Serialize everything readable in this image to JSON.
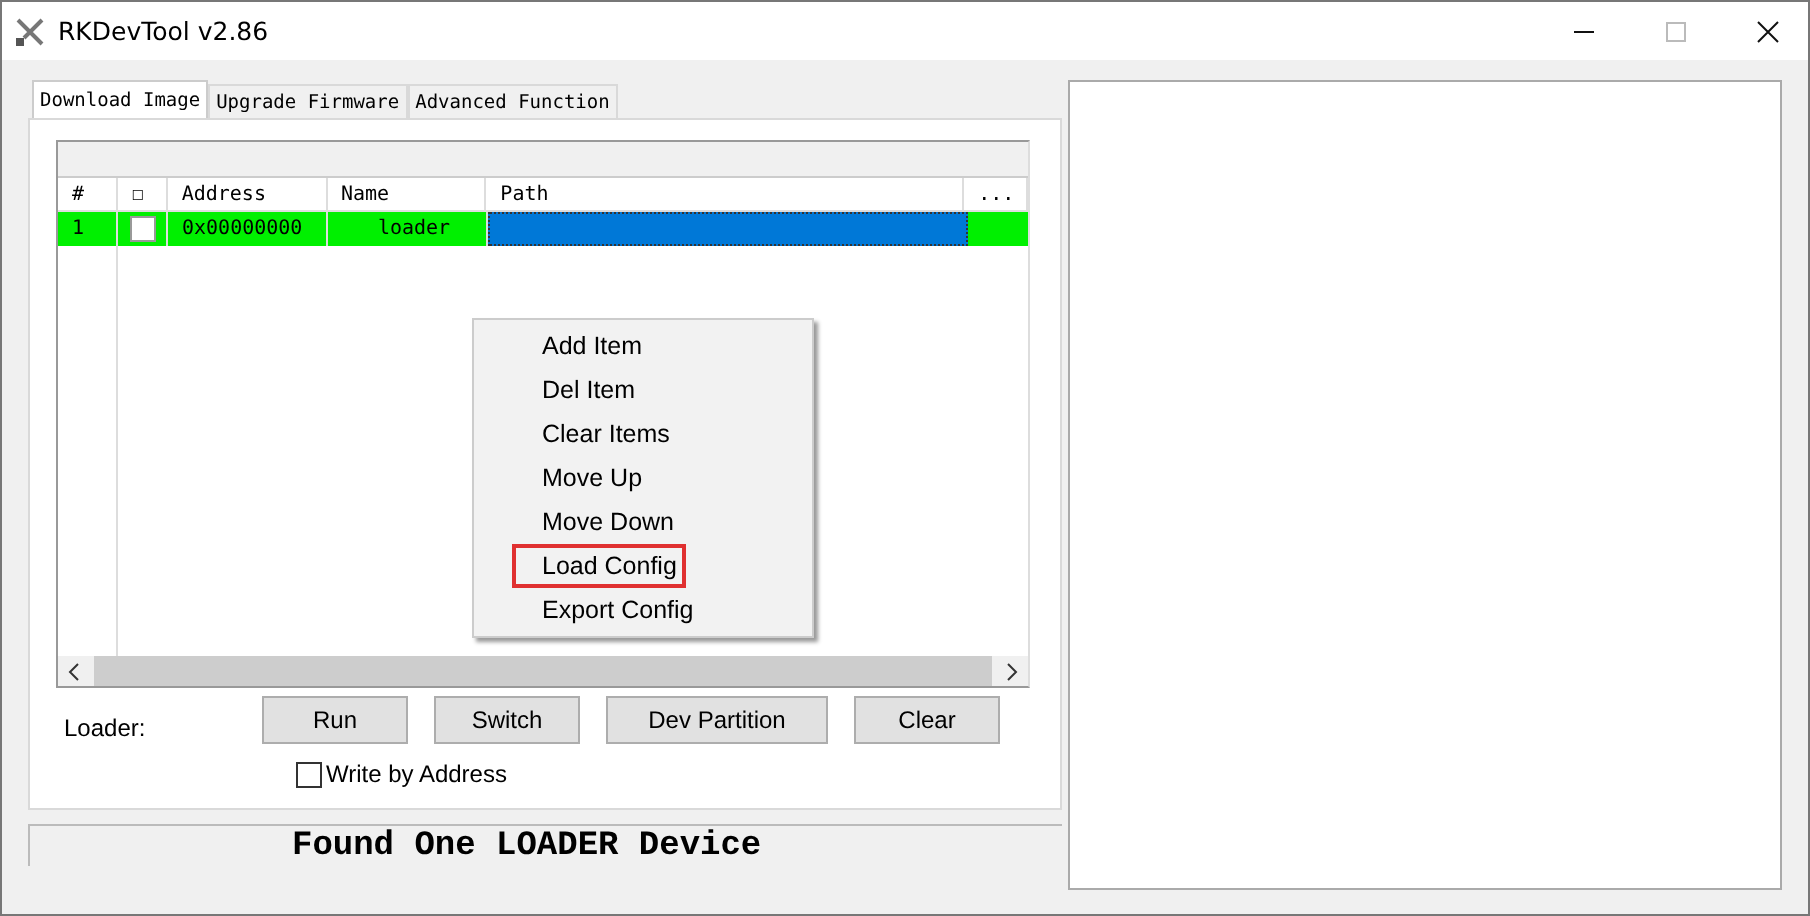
{
  "window": {
    "title": "RKDevTool v2.86"
  },
  "tabs": [
    {
      "label": "Download Image",
      "selected": true
    },
    {
      "label": "Upgrade Firmware",
      "selected": false
    },
    {
      "label": "Advanced Function",
      "selected": false
    }
  ],
  "table": {
    "columns": [
      "#",
      "☐",
      "Address",
      "Name",
      "Path",
      "..."
    ],
    "rows": [
      {
        "number": "1",
        "checked": false,
        "address": "0x00000000",
        "name": "loader",
        "path": "",
        "selected": true
      }
    ]
  },
  "context_menu": {
    "items": [
      {
        "label": "Add Item",
        "outlined": false
      },
      {
        "label": "Del Item",
        "outlined": false
      },
      {
        "label": "Clear Items",
        "outlined": false
      },
      {
        "label": "Move Up",
        "outlined": false
      },
      {
        "label": "Move Down",
        "outlined": false
      },
      {
        "label": "Load Config",
        "outlined": true
      },
      {
        "label": "Export Config",
        "outlined": false
      }
    ]
  },
  "loader_label": "Loader:",
  "buttons": [
    "Run",
    "Switch",
    "Dev Partition",
    "Clear"
  ],
  "write_by_address": {
    "label": "Write by Address",
    "checked": false
  },
  "status": "Found One LOADER Device"
}
